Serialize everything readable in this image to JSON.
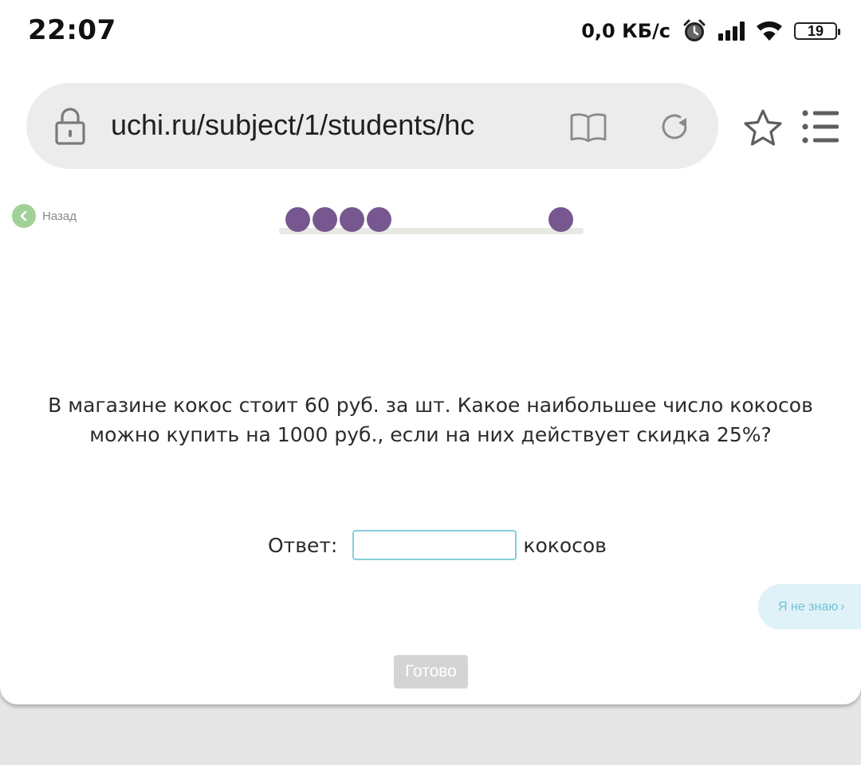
{
  "status_bar": {
    "time": "22:07",
    "net_speed": "0,0 КБ/с",
    "battery": "19",
    "icons": [
      "alarm-icon",
      "signal-icon",
      "wifi-icon",
      "battery-icon"
    ]
  },
  "browser": {
    "url": "uchi.ru/subject/1/students/hc",
    "icons": [
      "lock-icon",
      "reader-mode-icon",
      "reload-icon",
      "bookmark-star-icon",
      "menu-icon"
    ]
  },
  "page": {
    "back_label": "Назад",
    "progress": {
      "total_dots_visible": 5,
      "filled_dots": 5
    },
    "question": "В магазине кокос стоит 60 руб. за шт. Какое наибольшее число кокосов можно купить на 1000 руб., если на них действует скидка 25%?",
    "answer_label": "Ответ:",
    "answer_value": "",
    "answer_unit": "кокосов",
    "dont_know_label": "Я не знаю",
    "done_label": "Готово",
    "colors": {
      "accent_purple": "#76578f",
      "back_green": "#a2d198",
      "input_border": "#84cfd9",
      "dont_know_bg": "#dff2f7",
      "dont_know_text": "#6dc3d6",
      "done_disabled_bg": "#d4d4d4"
    }
  }
}
